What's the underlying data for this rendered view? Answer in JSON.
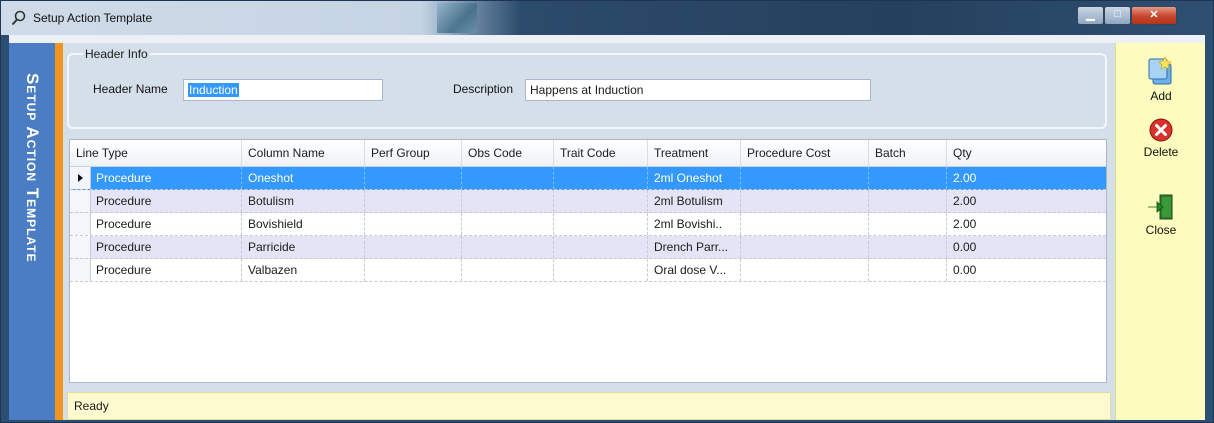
{
  "window": {
    "title": "Setup Action Template"
  },
  "colors": {
    "selection": "#3399ff",
    "banner": "#4a7dc4",
    "accent_strip": "#f0961e",
    "toolbar_bg": "#fdfbbd",
    "status_bg": "#fdfacf"
  },
  "sidebar": {
    "banner_text": "Setup Action Template"
  },
  "header_info": {
    "group_title": "Header Info",
    "header_name_label": "Header Name",
    "header_name_value": "Induction",
    "description_label": "Description",
    "description_value": "Happens at Induction"
  },
  "grid": {
    "columns": [
      "Line Type",
      "Column Name",
      "Perf Group",
      "Obs Code",
      "Trait Code",
      "Treatment",
      "Procedure Cost",
      "Batch",
      "Qty"
    ],
    "rows": [
      [
        "Procedure",
        "Oneshot",
        "",
        "",
        "",
        "2ml Oneshot",
        "",
        "",
        "2.00"
      ],
      [
        "Procedure",
        "Botulism",
        "",
        "",
        "",
        "2ml Botulism",
        "",
        "",
        "2.00"
      ],
      [
        "Procedure",
        "Bovishield",
        "",
        "",
        "",
        "2ml Bovishi..",
        "",
        "",
        "2.00"
      ],
      [
        "Procedure",
        "Parricide",
        "",
        "",
        "",
        "Drench Parr...",
        "",
        "",
        "0.00"
      ],
      [
        "Procedure",
        "Valbazen",
        "",
        "",
        "",
        "Oral dose V...",
        "",
        "",
        "0.00"
      ]
    ]
  },
  "status": {
    "text": "Ready"
  },
  "toolbar": {
    "add_label": "Add",
    "delete_label": "Delete",
    "close_label": "Close"
  }
}
